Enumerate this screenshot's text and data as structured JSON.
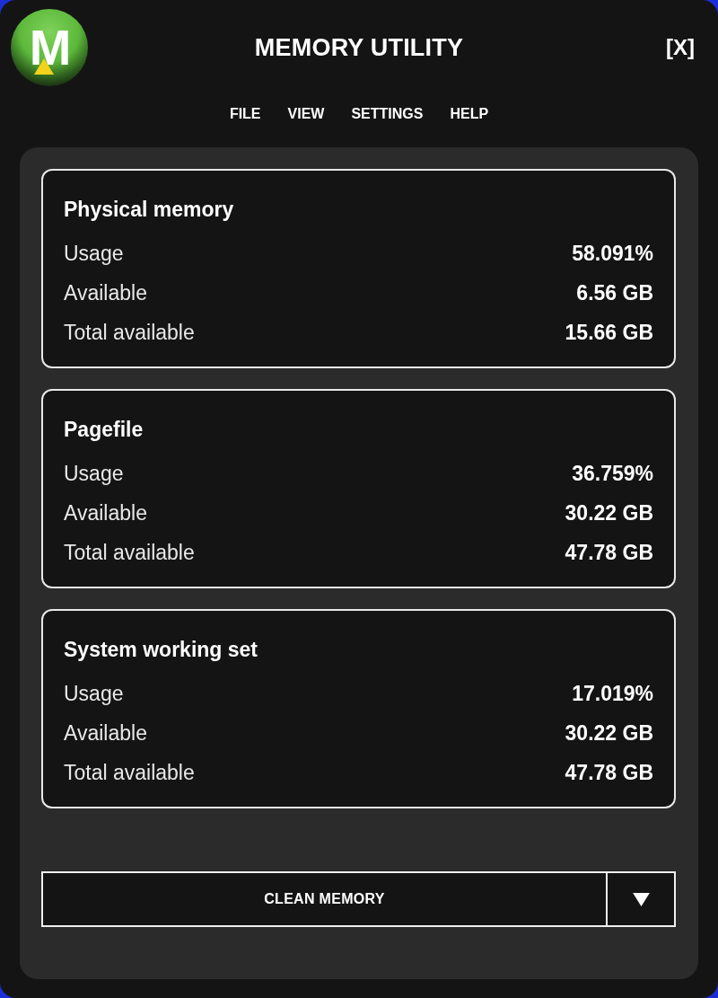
{
  "window": {
    "title": "MEMORY UTILITY",
    "close": "[X]"
  },
  "logo": {
    "letter": "M"
  },
  "menu": [
    "FILE",
    "VIEW",
    "SETTINGS",
    "HELP"
  ],
  "sections": [
    {
      "title": "Physical memory",
      "rows": [
        {
          "label": "Usage",
          "value": "58.091%"
        },
        {
          "label": "Available",
          "value": "6.56 GB"
        },
        {
          "label": "Total available",
          "value": "15.66 GB"
        }
      ]
    },
    {
      "title": "Pagefile",
      "rows": [
        {
          "label": "Usage",
          "value": "36.759%"
        },
        {
          "label": "Available",
          "value": "30.22 GB"
        },
        {
          "label": "Total available",
          "value": "47.78 GB"
        }
      ]
    },
    {
      "title": "System working set",
      "rows": [
        {
          "label": "Usage",
          "value": "17.019%"
        },
        {
          "label": "Available",
          "value": "30.22 GB"
        },
        {
          "label": "Total available",
          "value": "47.78 GB"
        }
      ]
    }
  ],
  "action": {
    "label": "CLEAN MEMORY"
  }
}
